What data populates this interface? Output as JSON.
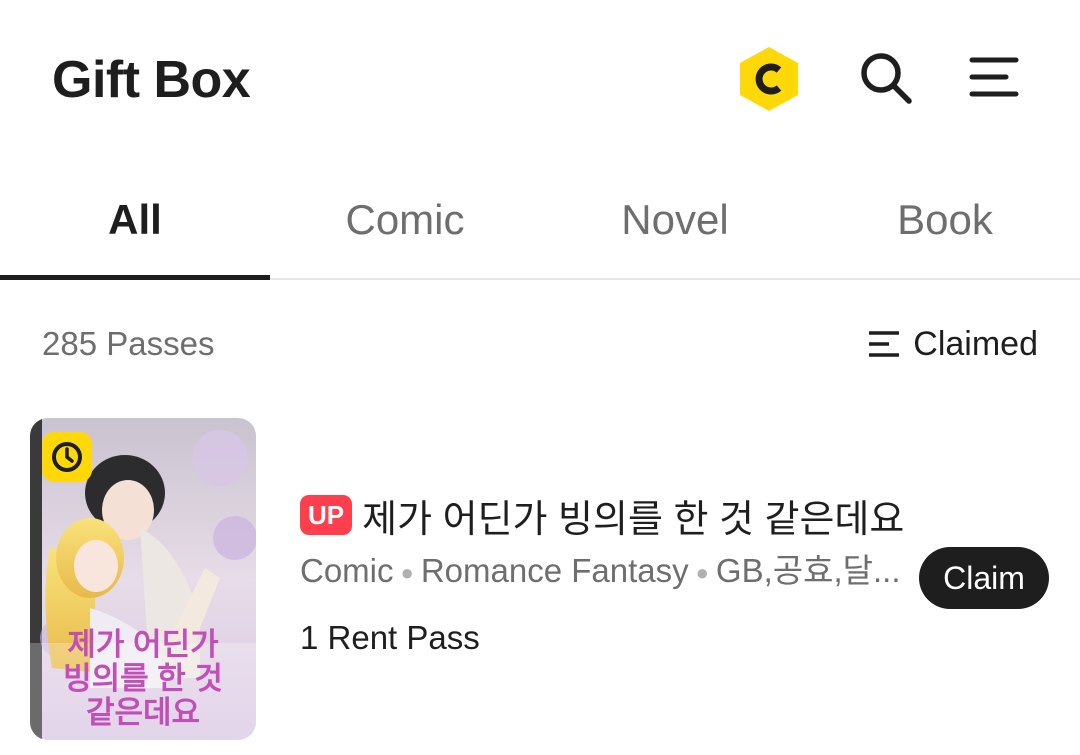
{
  "header": {
    "title": "Gift Box",
    "coin_icon": "coin-icon",
    "coin_color": "#ffd80a",
    "search_icon": "search-icon",
    "menu_icon": "menu-icon"
  },
  "tabs": [
    {
      "label": "All",
      "active": true
    },
    {
      "label": "Comic",
      "active": false
    },
    {
      "label": "Novel",
      "active": false
    },
    {
      "label": "Book",
      "active": false
    }
  ],
  "subbar": {
    "count_text": "285 Passes",
    "sort_label": "Claimed",
    "sort_icon": "sort-icon"
  },
  "items": [
    {
      "badge": "UP",
      "badge_color": "#ff3f4e",
      "title": "제가 어딘가 빙의를 한 것 같은데요",
      "type": "Comic",
      "genre": "Romance Fantasy",
      "tags": "GB,공효,달...",
      "pass_text": "1 Rent Pass",
      "claim_label": "Claim",
      "cover_title_lines": [
        "제가 어딘가",
        "빙의를 한 것",
        "같은데요"
      ],
      "cover_icon": "clock-icon"
    }
  ]
}
